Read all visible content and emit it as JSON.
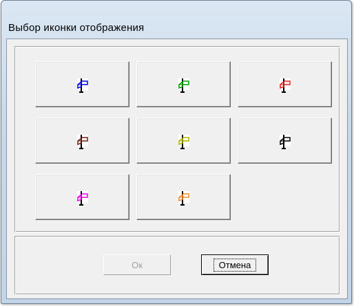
{
  "window": {
    "title": "Выбор иконки отображения"
  },
  "icons": [
    {
      "name": "blue",
      "color": "#0000e6"
    },
    {
      "name": "green",
      "color": "#00a000"
    },
    {
      "name": "red",
      "color": "#e61e1e"
    },
    {
      "name": "brown",
      "color": "#6e1e14"
    },
    {
      "name": "olive",
      "color": "#b4b400"
    },
    {
      "name": "black",
      "color": "#000000"
    },
    {
      "name": "magenta",
      "color": "#e600e6"
    },
    {
      "name": "orange",
      "color": "#f08c28"
    }
  ],
  "buttons": {
    "ok_label": "Ок",
    "cancel_label": "Отмена"
  }
}
